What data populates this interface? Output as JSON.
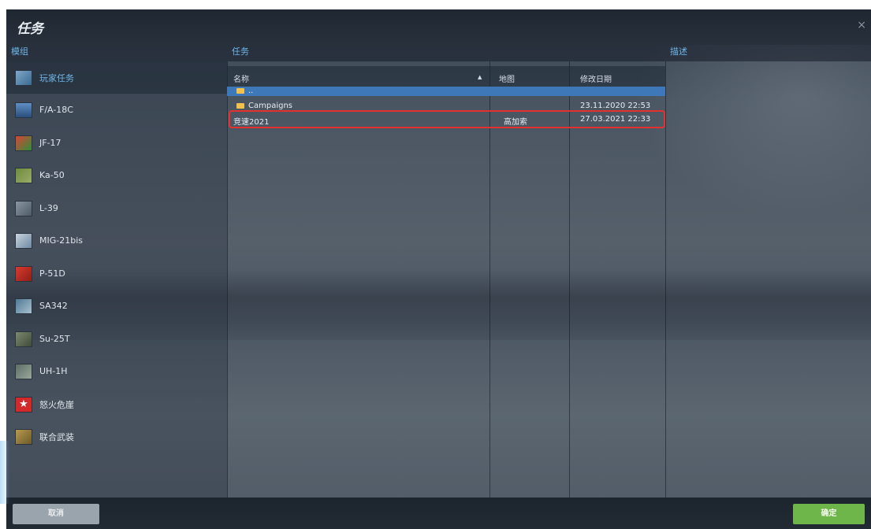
{
  "window": {
    "title": "任务",
    "close": "×"
  },
  "columns": {
    "modules": "模组",
    "missions": "任务",
    "description": "描述"
  },
  "sidebar": {
    "items": [
      {
        "label": "玩家任务",
        "icon": "globe-icon",
        "active": true
      },
      {
        "label": "F/A-18C",
        "icon": "fa18c-icon"
      },
      {
        "label": "JF-17",
        "icon": "jf17-icon"
      },
      {
        "label": "Ka-50",
        "icon": "ka50-icon"
      },
      {
        "label": "L-39",
        "icon": "l39-icon"
      },
      {
        "label": "MIG-21bis",
        "icon": "mig21-icon"
      },
      {
        "label": "P-51D",
        "icon": "p51d-icon"
      },
      {
        "label": "SA342",
        "icon": "sa342-icon"
      },
      {
        "label": "Su-25T",
        "icon": "su25t-icon"
      },
      {
        "label": "UH-1H",
        "icon": "uh1h-icon"
      },
      {
        "label": "怒火危崖",
        "icon": "star-icon"
      },
      {
        "label": "联合武装",
        "icon": "combined-arms-icon"
      }
    ]
  },
  "table": {
    "headers": {
      "name": "名称",
      "sort_indicator": "▲",
      "map": "地图",
      "modified": "修改日期"
    },
    "rows": [
      {
        "name": "..",
        "map": "",
        "modified": "",
        "folder": true,
        "selected": true
      },
      {
        "name": "Campaigns",
        "map": "",
        "modified": "23.11.2020 22:53",
        "folder": true
      },
      {
        "name": "竞速2021",
        "map": "高加索",
        "modified": "27.03.2021 22:33",
        "folder": false,
        "highlighted": true
      }
    ]
  },
  "footer": {
    "cancel_label": "取消",
    "ok_label": "确定"
  },
  "colors": {
    "accent": "#6fb6e8",
    "selected_row": "#3f78b8",
    "ok_button": "#6fb64a",
    "highlight_box": "#e53030"
  }
}
